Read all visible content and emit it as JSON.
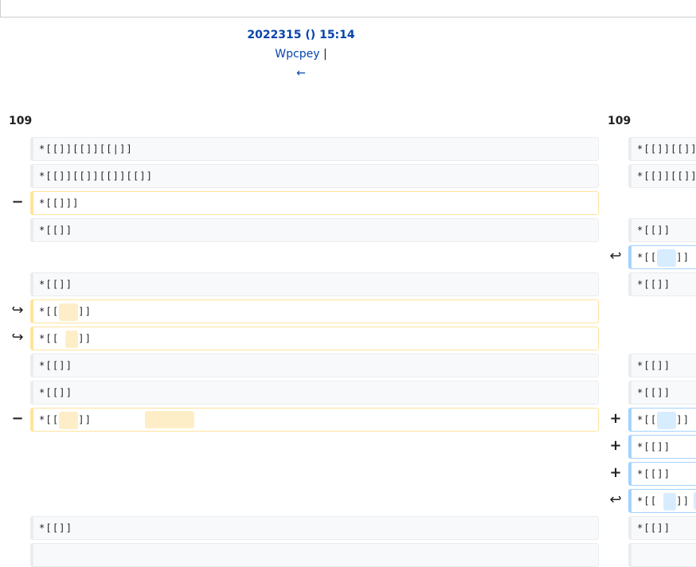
{
  "header": {
    "revision_title": "2022315 () 15:14",
    "user": "Wpcpey",
    "user_separator": "|",
    "nav_older": "←"
  },
  "left_line_number": "109",
  "right_line_number": "109",
  "markers": {
    "removed": "−",
    "added": "+",
    "moved_from": "↪",
    "moved_to": "↩"
  },
  "rows": [
    {
      "left": "*[[]][[]][[|]]",
      "right": "*[[]][[]][[|]]"
    },
    {
      "left": "*[[]][[]][[]][[]]",
      "right": "*[[]][[]][[]][[]]"
    },
    {
      "left": "*[[]]]"
    },
    {
      "left": "*[[]]",
      "right": "*[[]]"
    },
    {
      "right_prefix": "*[[",
      "right_suffix": "]]"
    },
    {
      "left": "*[[]]",
      "right": "*[[]]"
    },
    {
      "left_prefix": "*[[",
      "left_suffix": "]]"
    },
    {
      "left_prefix": "*[[",
      "left_suffix": "]]"
    },
    {
      "left": "*[[]]",
      "right": "*[[]]"
    },
    {
      "left": "*[[]]",
      "right": "*[[]]"
    },
    {
      "left_prefix": "*[[",
      "left_suffix": "]]",
      "right_prefix": "*[[",
      "right_suffix": "]]"
    },
    {
      "right": "*[[]]"
    },
    {
      "right": "*[[]]"
    },
    {
      "right_prefix": "*[[",
      "right_suffix": "]]"
    },
    {
      "left": "*[[]]",
      "right": "*[[]]"
    }
  ]
}
